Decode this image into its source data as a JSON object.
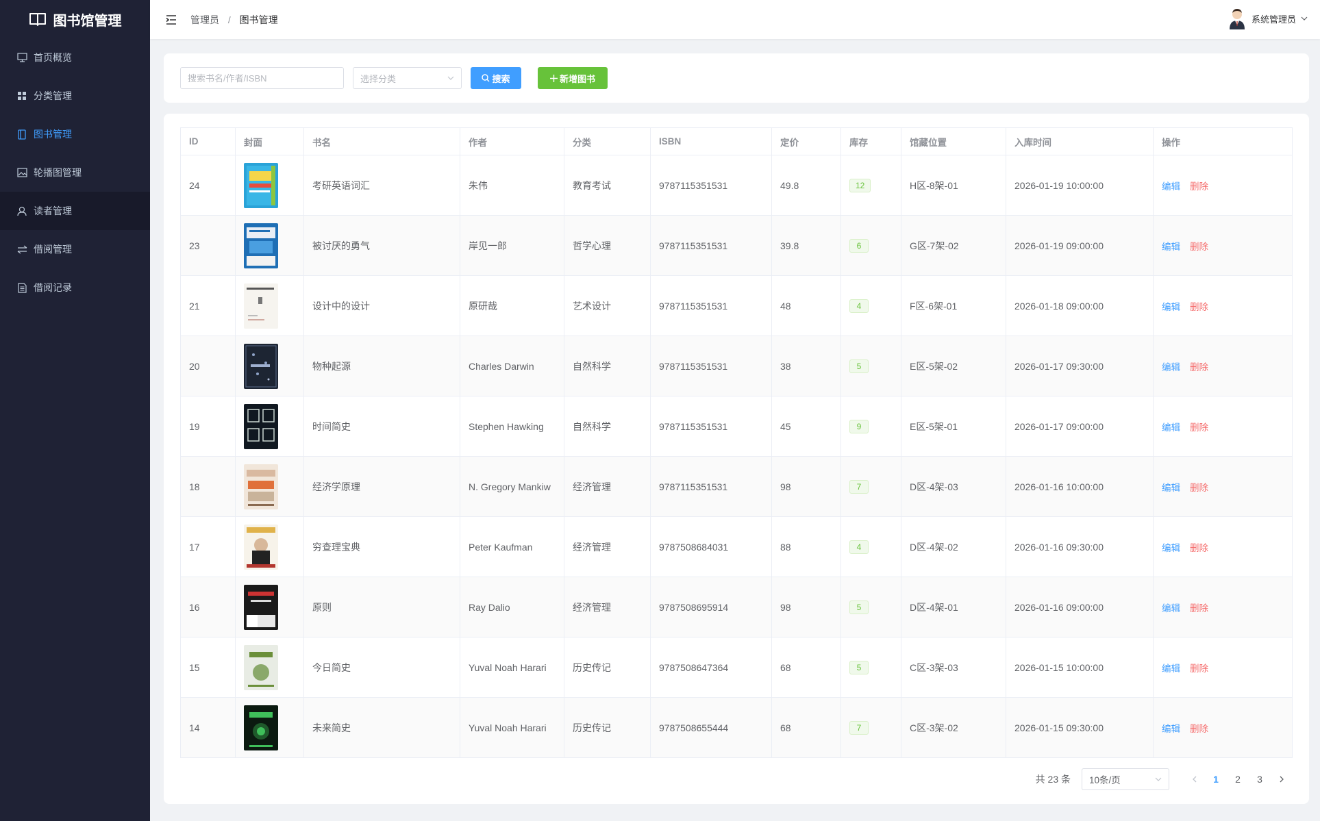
{
  "sidebar": {
    "title": "图书馆管理",
    "items": [
      {
        "label": "首页概览",
        "icon": "monitor-icon"
      },
      {
        "label": "分类管理",
        "icon": "grid-icon"
      },
      {
        "label": "图书管理",
        "icon": "book-icon"
      },
      {
        "label": "轮播图管理",
        "icon": "picture-icon"
      },
      {
        "label": "读者管理",
        "icon": "user-icon"
      },
      {
        "label": "借阅管理",
        "icon": "swap-icon"
      },
      {
        "label": "借阅记录",
        "icon": "document-icon"
      }
    ]
  },
  "header": {
    "breadcrumb": [
      "管理员",
      "图书管理"
    ],
    "breadcrumb_sep": "/",
    "user_name": "系统管理员"
  },
  "search": {
    "placeholder": "搜索书名/作者/ISBN",
    "category_placeholder": "选择分类",
    "search_label": "搜索",
    "add_label": "新增图书"
  },
  "table": {
    "columns": [
      "ID",
      "封面",
      "书名",
      "作者",
      "分类",
      "ISBN",
      "定价",
      "库存",
      "馆藏位置",
      "入库时间",
      "操作"
    ],
    "edit_label": "编辑",
    "delete_label": "删除",
    "rows": [
      {
        "id": "24",
        "title": "考研英语词汇",
        "author": "朱伟",
        "category": "教育考试",
        "isbn": "9787115351531",
        "price": "49.8",
        "stock": "12",
        "location": "H区-8架-01",
        "time": "2026-01-19 10:00:00"
      },
      {
        "id": "23",
        "title": "被讨厌的勇气",
        "author": "岸见一郎",
        "category": "哲学心理",
        "isbn": "9787115351531",
        "price": "39.8",
        "stock": "6",
        "location": "G区-7架-02",
        "time": "2026-01-19 09:00:00"
      },
      {
        "id": "21",
        "title": "设计中的设计",
        "author": "原研哉",
        "category": "艺术设计",
        "isbn": "9787115351531",
        "price": "48",
        "stock": "4",
        "location": "F区-6架-01",
        "time": "2026-01-18 09:00:00"
      },
      {
        "id": "20",
        "title": "物种起源",
        "author": "Charles Darwin",
        "category": "自然科学",
        "isbn": "9787115351531",
        "price": "38",
        "stock": "5",
        "location": "E区-5架-02",
        "time": "2026-01-17 09:30:00"
      },
      {
        "id": "19",
        "title": "时间简史",
        "author": "Stephen Hawking",
        "category": "自然科学",
        "isbn": "9787115351531",
        "price": "45",
        "stock": "9",
        "location": "E区-5架-01",
        "time": "2026-01-17 09:00:00"
      },
      {
        "id": "18",
        "title": "经济学原理",
        "author": "N. Gregory Mankiw",
        "category": "经济管理",
        "isbn": "9787115351531",
        "price": "98",
        "stock": "7",
        "location": "D区-4架-03",
        "time": "2026-01-16 10:00:00"
      },
      {
        "id": "17",
        "title": "穷查理宝典",
        "author": "Peter Kaufman",
        "category": "经济管理",
        "isbn": "9787508684031",
        "price": "88",
        "stock": "4",
        "location": "D区-4架-02",
        "time": "2026-01-16 09:30:00"
      },
      {
        "id": "16",
        "title": "原则",
        "author": "Ray Dalio",
        "category": "经济管理",
        "isbn": "9787508695914",
        "price": "98",
        "stock": "5",
        "location": "D区-4架-01",
        "time": "2026-01-16 09:00:00"
      },
      {
        "id": "15",
        "title": "今日简史",
        "author": "Yuval Noah Harari",
        "category": "历史传记",
        "isbn": "9787508647364",
        "price": "68",
        "stock": "5",
        "location": "C区-3架-03",
        "time": "2026-01-15 10:00:00"
      },
      {
        "id": "14",
        "title": "未来简史",
        "author": "Yuval Noah Harari",
        "category": "历史传记",
        "isbn": "9787508655444",
        "price": "68",
        "stock": "7",
        "location": "C区-3架-02",
        "time": "2026-01-15 09:30:00"
      }
    ]
  },
  "pagination": {
    "total_text": "共 23 条",
    "page_size": "10条/页",
    "pages": [
      "1",
      "2",
      "3"
    ],
    "current": "1"
  },
  "colors": {
    "sidebar_bg": "#1f2235",
    "primary": "#409eff",
    "success": "#67c23a",
    "danger": "#f56c6c"
  }
}
